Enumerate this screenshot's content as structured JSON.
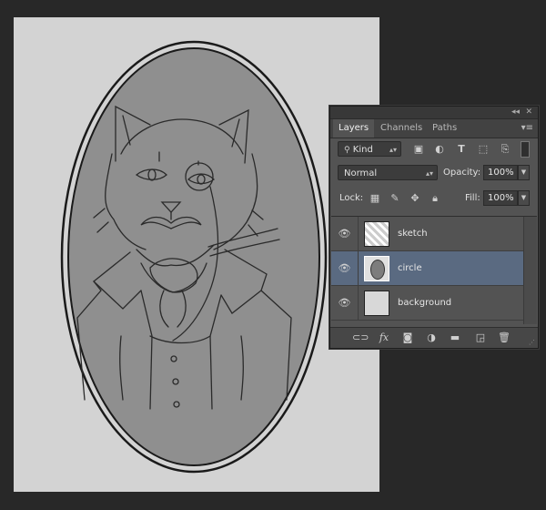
{
  "panel": {
    "collapse_icon": "double-chevron-icon",
    "close_icon": "close-icon",
    "tabs": [
      {
        "label": "Layers",
        "active": true
      },
      {
        "label": "Channels",
        "active": false
      },
      {
        "label": "Paths",
        "active": false
      }
    ],
    "menu_icon": "panel-menu-icon",
    "filter": {
      "kind_label": "Kind",
      "filter_icons": [
        "image-filter-icon",
        "adjustment-filter-icon",
        "type-filter-icon",
        "shape-filter-icon",
        "smart-object-filter-icon",
        "filter-toggle-icon"
      ]
    },
    "blend_mode": "Normal",
    "opacity_label": "Opacity:",
    "opacity_value": "100%",
    "lock_label": "Lock:",
    "lock_icons": [
      "lock-transparent-icon",
      "lock-image-icon",
      "lock-position-icon",
      "lock-all-icon"
    ],
    "fill_label": "Fill:",
    "fill_value": "100%",
    "layers": [
      {
        "name": "sketch",
        "visible": true,
        "selected": false
      },
      {
        "name": "circle",
        "visible": true,
        "selected": true
      },
      {
        "name": "background",
        "visible": true,
        "selected": false
      }
    ],
    "footer_icons": [
      "link-icon",
      "fx-icon",
      "mask-icon",
      "adjustment-icon",
      "folder-icon",
      "new-layer-icon",
      "trash-icon"
    ]
  },
  "colors": {
    "workspace": "#282828",
    "canvas": "#d3d3d3",
    "panel": "#535353",
    "selected_layer": "#5a6a81",
    "oval_fill": "#8f8f8f"
  }
}
